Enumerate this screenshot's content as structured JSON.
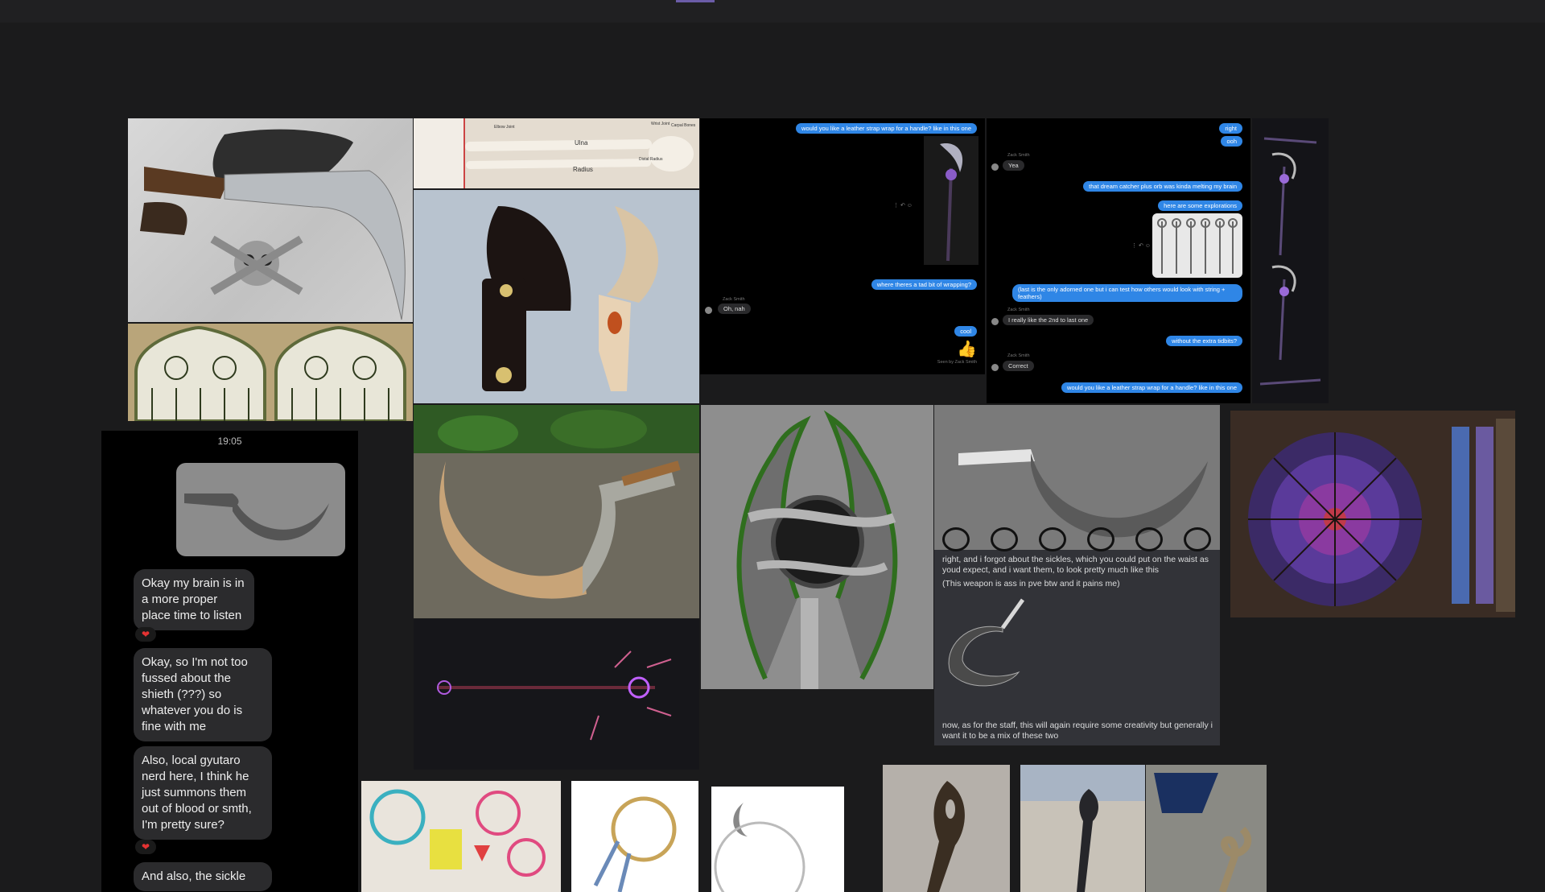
{
  "tiles": {
    "kukri_skull": "kukri knife with sheath and skull buckle",
    "gothic_windows": "gothic tracery windows",
    "arm_bones": "arm bone anatomy diagram",
    "sickle_sheath": "leather sheath with sickle blade",
    "sickle_log": "carved wooden sickle on a log",
    "dark_staff": "dark staff render with purple glow",
    "eye_sketch": "sketch of staff head with orb",
    "cathedral_rose": "cathedral rose window",
    "dreamcatcher_1": "colorful dreamcatchers",
    "dreamcatcher_2": "dreamcatcher with feathers",
    "dreamcatcher_3": "moon dreamcatcher",
    "wooden_staff": "carved wooden staff",
    "beach_staff": "staff on a beach",
    "chair_staff": "twisted staff near chairs"
  },
  "chat1": {
    "msg1": "would you like a leather strap wrap for a handle? like in this one",
    "msg2": "where theres a tad bit of wrapping?",
    "sender": "Zack Smith",
    "reply1": "Oh, nah",
    "msg3": "cool",
    "seen": "Seen by Zack Smith",
    "thumb": "👍"
  },
  "chat2": {
    "msg1": "right",
    "msg2": "ooh",
    "sender": "Zack Smith",
    "reply1": "Yea",
    "msg3": "that dream catcher plus orb was kinda melting my brain",
    "msg4": "here are some explorations",
    "msg5": "(last is the only adorned one but i can test how others would look with string + feathers)",
    "reply2": "I really like the 2nd to last one",
    "msg6": "without the extra tidbits?",
    "reply3": "Correct",
    "msg7": "would you like a leather strap wrap for a handle? like in this one"
  },
  "phone": {
    "time": "19:05",
    "bubble1": "Okay my brain is in a more proper place time to listen",
    "bubble2": "Okay, so I'm not too fussed about the shieth (???) so whatever you do is fine with me",
    "bubble3": "Also, local gyutaro nerd here, I think he just summons them out of blood or smth, I'm pretty sure?",
    "bubble4": "And also, the sickle",
    "heart": "❤"
  },
  "discord": {
    "text1": "right, and i forgot about the sickles, which you could put on the waist as youd expect, and i want them, to look pretty much like this",
    "text2": "(This weapon is ass in pve btw and it pains me)",
    "text3": "now, as for the staff, this will again require some creativity but generally i want it to be a mix of these two"
  },
  "bones": {
    "ulna": "Ulna",
    "radius": "Radius",
    "elbow": "Elbow Joint",
    "wrist": "Wrist Joint",
    "distal": "Distal Radius",
    "carpal": "Carpal Bones"
  },
  "colors": {
    "chat_blue": "#2f86e6",
    "heart_red": "#e53232",
    "sketch_green": "#2f6e1e"
  }
}
